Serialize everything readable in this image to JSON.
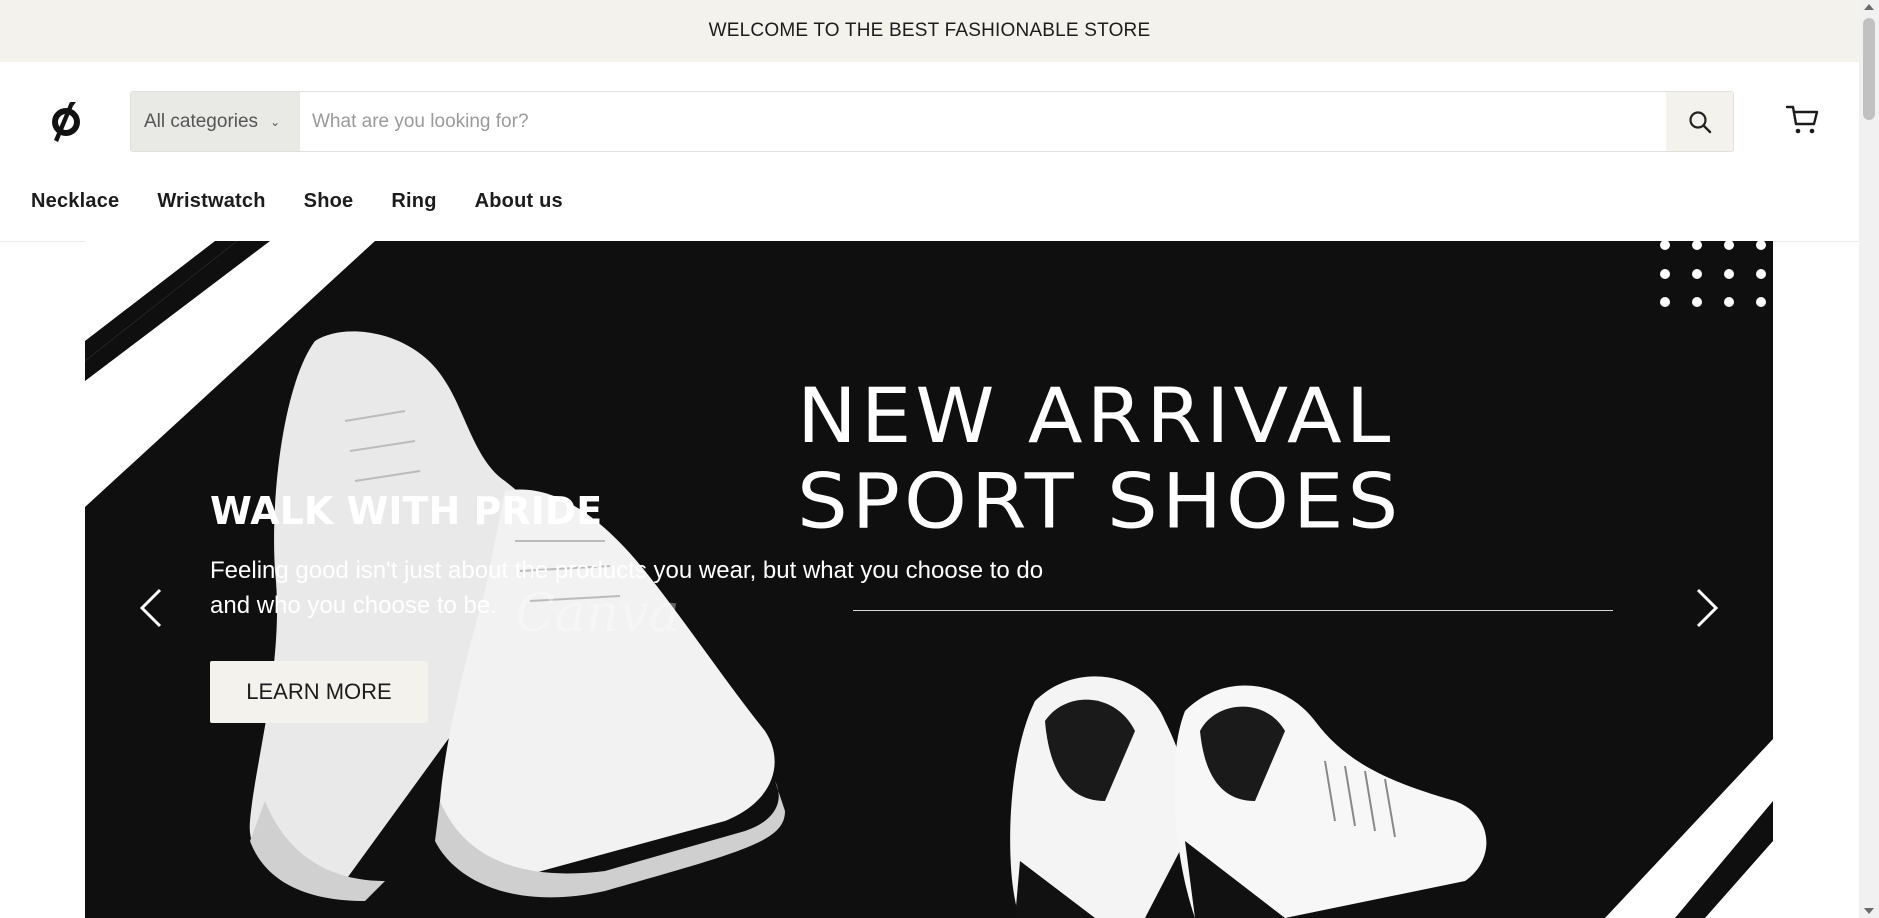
{
  "announcement": "WELCOME TO THE BEST FASHIONABLE STORE",
  "header": {
    "logo_icon": "peloton-style-logo",
    "category_select": "All categories",
    "search_placeholder": "What are you looking for?",
    "search_icon": "search-icon",
    "cart_icon": "cart-icon"
  },
  "nav": {
    "items": [
      {
        "label": "Necklace"
      },
      {
        "label": "Wristwatch"
      },
      {
        "label": "Shoe"
      },
      {
        "label": "Ring"
      },
      {
        "label": "About us"
      }
    ]
  },
  "hero": {
    "title_line1": "NEW ARRIVAL",
    "title_line2": "SPORT SHOES",
    "heading": "WALK WITH PRIDE",
    "text_line1": "Feeling good isn't just about the products you wear, but what you choose to do",
    "text_line2": "and who you choose to be.",
    "button_label": "LEARN MORE",
    "watermark": "Canva",
    "prev_icon": "chevron-left-icon",
    "next_icon": "chevron-right-icon"
  },
  "colors": {
    "announcement_bg": "#f3f2ed",
    "hero_bg": "#0f0f0f",
    "button_bg": "#f3f2ed",
    "text_dark": "#1c1c1c"
  }
}
